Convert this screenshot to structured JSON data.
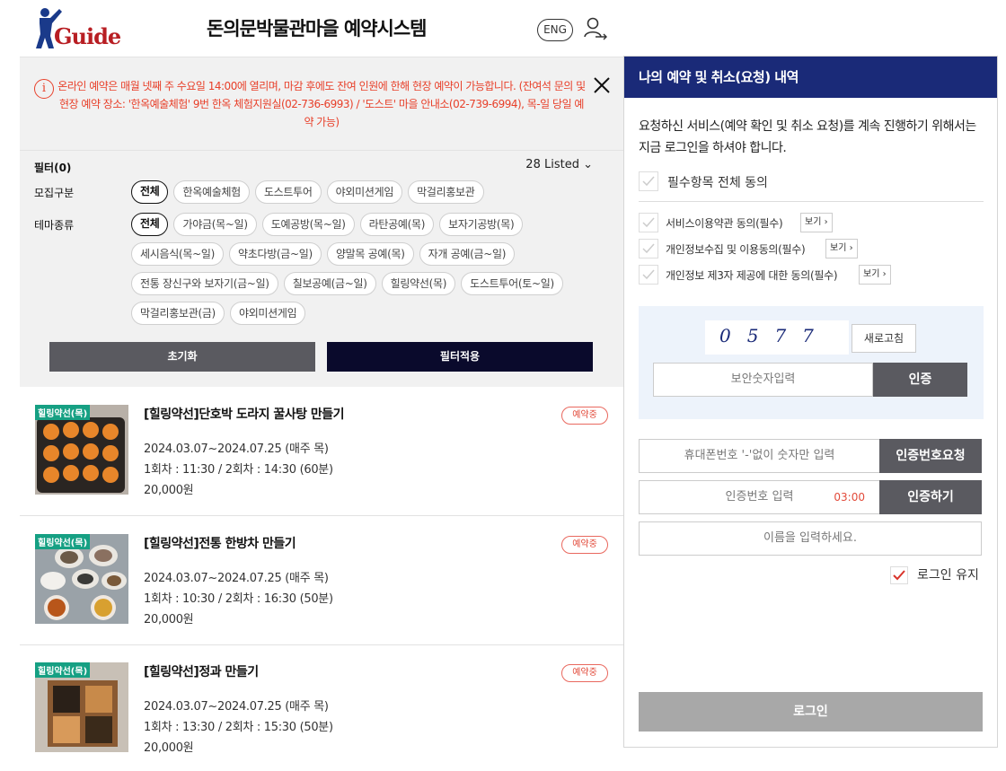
{
  "header": {
    "logo_text": "Guide",
    "title": "돈의문박물관마을 예약시스템",
    "lang_button": "ENG"
  },
  "notice": {
    "text": "온라인 예약은 매월 넷째 주 수요일 14:00에 열리며, 마감 후에도 잔여 인원에 한해 현장 예약이 가능합니다. (잔여석 문의 및 현장 예약 장소: '한옥예술체험' 9번 한옥 체험지원실(02-736-6993) / '도스트' 마을 안내소(02-739-6994), 목-일 당일 예약 가능)"
  },
  "filter": {
    "count_label": "필터(0)",
    "listed": "28 Listed",
    "recruit_label": "모집구분",
    "recruit_chips": [
      "전체",
      "한옥예술체험",
      "도스트투어",
      "야외미션게임",
      "막걸리홍보관"
    ],
    "theme_label": "테마종류",
    "theme_chips": [
      "전체",
      "가야금(목~일)",
      "도예공방(목~일)",
      "라탄공예(목)",
      "보자기공방(목)",
      "세시음식(목~일)",
      "약초다방(금~일)",
      "양말목 공예(목)",
      "자개 공예(금~일)",
      "전통 장신구와 보자기(금~일)",
      "칠보공예(금~일)",
      "힐링약선(목)",
      "도스트투어(토~일)",
      "막걸리홍보관(금)",
      "야외미션게임"
    ],
    "reset_label": "초기화",
    "apply_label": "필터적용"
  },
  "programs": [
    {
      "category": "힐링약선(목)",
      "title": "[힐링약선]단호박 도라지 꿀사탕 만들기",
      "status": "예약중",
      "period": "2024.03.07~2024.07.25 (매주 목)",
      "sessions": "1회차 : 11:30 / 2회차 : 14:30 (60분)",
      "price": "20,000원"
    },
    {
      "category": "힐링약선(목)",
      "title": "[힐링약선]전통 한방차 만들기",
      "status": "예약중",
      "period": "2024.03.07~2024.07.25 (매주 목)",
      "sessions": "1회차 : 10:30 / 2회차 : 16:30 (50분)",
      "price": "20,000원"
    },
    {
      "category": "힐링약선(목)",
      "title": "[힐링약선]정과 만들기",
      "status": "예약중",
      "period": "2024.03.07~2024.07.25 (매주 목)",
      "sessions": "1회차 : 13:30 / 2회차 : 15:30 (50분)",
      "price": "20,000원"
    }
  ],
  "panel": {
    "title": "나의 예약 및 취소(요청) 내역",
    "message": "요청하신 서비스(예약 확인 및 취소 요청)를 계속 진행하기 위해서는 지금 로그인을 하셔야 합니다.",
    "agree_all": "필수항목 전체 동의",
    "agreements": [
      {
        "label": "서비스이용약관 동의(필수)",
        "view": "보기"
      },
      {
        "label": "개인정보수집 및 이용동의(필수)",
        "view": "보기"
      },
      {
        "label": "개인정보 제3자 제공에 대한 동의(필수)",
        "view": "보기"
      }
    ],
    "captcha_code": "0577",
    "refresh_label": "새로고침",
    "captcha_placeholder": "보안숫자입력",
    "captcha_button": "인증",
    "phone_placeholder": "휴대폰번호 '-'없이 숫자만 입력",
    "phone_button": "인증번호요청",
    "code_placeholder": "인증번호 입력",
    "timer": "03:00",
    "code_button": "인증하기",
    "name_placeholder": "이름을 입력하세요.",
    "keep_login": "로그인 유지",
    "login_button": "로그인"
  },
  "colors": {
    "panel_header": "#1a2a78",
    "notice_text": "#e8402a",
    "category_badge": "#16a083",
    "apply_button": "#0a0a2c"
  }
}
